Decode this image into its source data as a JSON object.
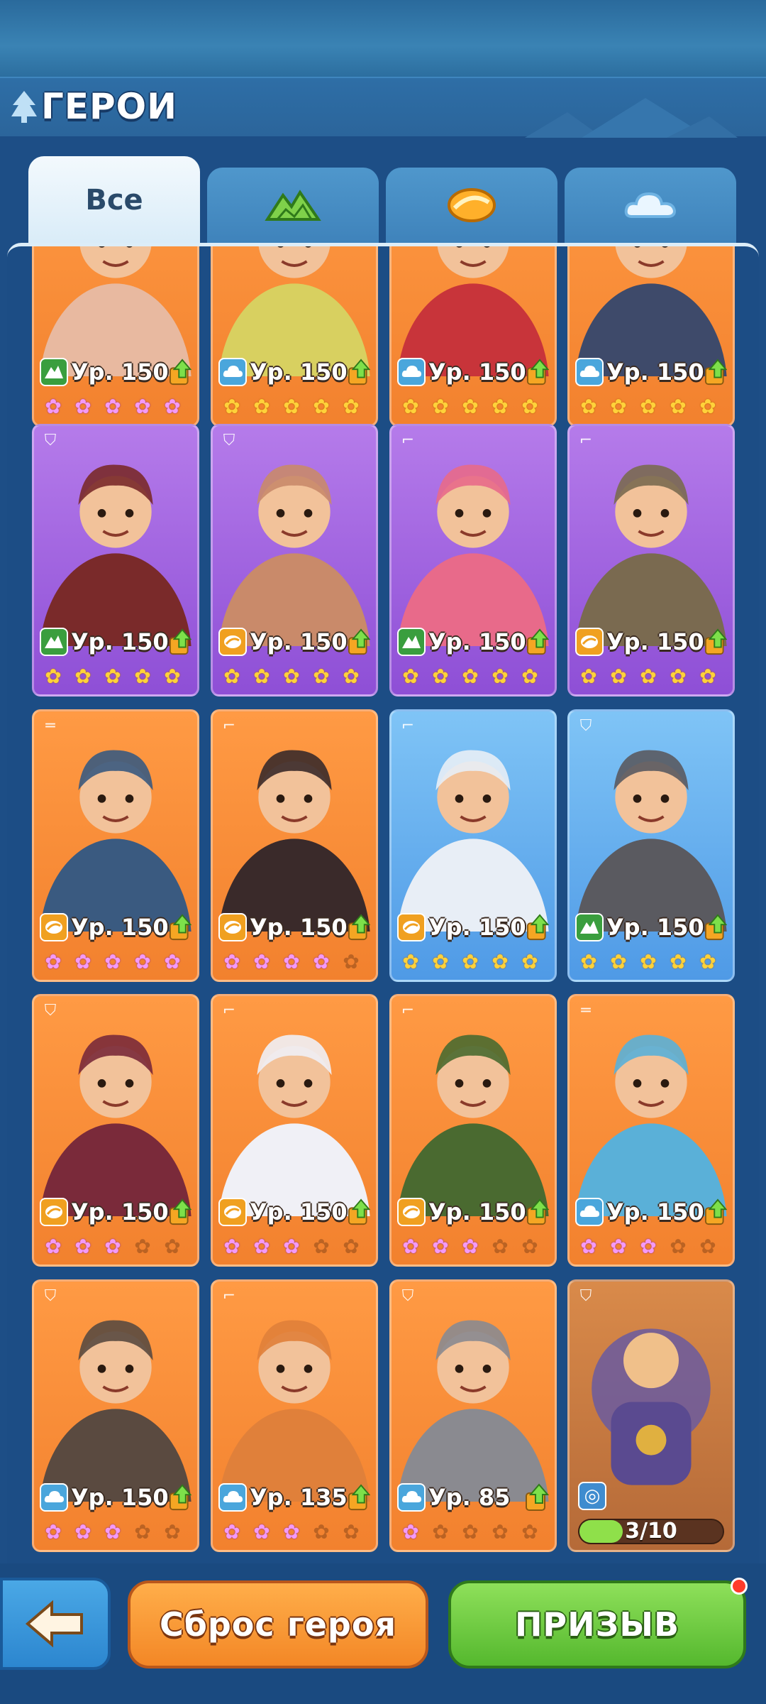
{
  "header": {
    "title": "ГЕРОИ"
  },
  "tabs": [
    {
      "label": "Все",
      "icon": "all"
    },
    {
      "label": "",
      "icon": "mountain-element-icon"
    },
    {
      "label": "",
      "icon": "sun-element-icon"
    },
    {
      "label": "",
      "icon": "cloud-element-icon"
    }
  ],
  "colors": {
    "gold_star": "#ffd23a",
    "pink_star": "#f49af7",
    "orange_card": "#f2812e",
    "purple_card": "#8e4fd6",
    "blue_card": "#4f9ae6",
    "progress_fill": "#8fe04a"
  },
  "heroes": [
    {
      "row": 0,
      "col": 0,
      "element": "mountain",
      "level": "Ур. 150",
      "card": "orange",
      "class": "",
      "stars": [
        "pink",
        "pink",
        "pink",
        "pink",
        "pink"
      ],
      "figure": "#e8b9a0"
    },
    {
      "row": 0,
      "col": 1,
      "element": "cloud",
      "level": "Ур. 150",
      "card": "orange",
      "class": "",
      "stars": [
        "gold",
        "gold",
        "gold",
        "gold",
        "gold"
      ],
      "figure": "#d8d060"
    },
    {
      "row": 0,
      "col": 2,
      "element": "cloud",
      "level": "Ур. 150",
      "card": "orange",
      "class": "",
      "stars": [
        "gold",
        "gold",
        "gold",
        "gold",
        "gold"
      ],
      "figure": "#c8343a"
    },
    {
      "row": 0,
      "col": 3,
      "element": "cloud",
      "level": "Ур. 150",
      "card": "orange",
      "class": "",
      "stars": [
        "gold",
        "gold",
        "gold",
        "gold",
        "gold"
      ],
      "figure": "#3e4a6a"
    },
    {
      "row": 1,
      "col": 0,
      "element": "mountain",
      "level": "Ур. 150",
      "card": "purple",
      "class": "shield",
      "stars": [
        "gold",
        "gold",
        "gold",
        "gold",
        "gold"
      ],
      "figure": "#7a2a2a"
    },
    {
      "row": 1,
      "col": 1,
      "element": "sun",
      "level": "Ур. 150",
      "card": "purple",
      "class": "shield",
      "stars": [
        "gold",
        "gold",
        "gold",
        "gold",
        "gold"
      ],
      "figure": "#c98a6a"
    },
    {
      "row": 1,
      "col": 2,
      "element": "mountain",
      "level": "Ур. 150",
      "card": "purple",
      "class": "gun",
      "stars": [
        "gold",
        "gold",
        "gold",
        "gold",
        "gold"
      ],
      "figure": "#e86a8a"
    },
    {
      "row": 1,
      "col": 3,
      "element": "sun",
      "level": "Ур. 150",
      "card": "purple",
      "class": "gun",
      "stars": [
        "gold",
        "gold",
        "gold",
        "gold",
        "gold"
      ],
      "figure": "#7a6a50"
    },
    {
      "row": 2,
      "col": 0,
      "element": "sun",
      "level": "Ур. 150",
      "card": "orange",
      "class": "rifle",
      "stars": [
        "pink",
        "pink",
        "pink",
        "pink",
        "pink"
      ],
      "figure": "#3a5a80"
    },
    {
      "row": 2,
      "col": 1,
      "element": "sun",
      "level": "Ур. 150",
      "card": "orange",
      "class": "gun",
      "stars": [
        "pink",
        "pink",
        "pink",
        "pink",
        "empty"
      ],
      "figure": "#3a2a2a"
    },
    {
      "row": 2,
      "col": 2,
      "element": "sun",
      "level": "Ур. 150",
      "card": "blue",
      "class": "gun",
      "stars": [
        "gold",
        "gold",
        "gold",
        "gold",
        "gold"
      ],
      "figure": "#e8eef6"
    },
    {
      "row": 2,
      "col": 3,
      "element": "mountain",
      "level": "Ур. 150",
      "card": "blue",
      "class": "shield",
      "stars": [
        "gold",
        "gold",
        "gold",
        "gold",
        "gold"
      ],
      "figure": "#5a5a60"
    },
    {
      "row": 3,
      "col": 0,
      "element": "sun",
      "level": "Ур. 150",
      "card": "orange",
      "class": "shield",
      "stars": [
        "pink",
        "pink",
        "pink",
        "empty",
        "empty"
      ],
      "figure": "#7a2a3a"
    },
    {
      "row": 3,
      "col": 1,
      "element": "sun",
      "level": "Ур. 150",
      "card": "orange",
      "class": "gun",
      "stars": [
        "pink",
        "pink",
        "pink",
        "empty",
        "empty"
      ],
      "figure": "#f0f0f6"
    },
    {
      "row": 3,
      "col": 2,
      "element": "sun",
      "level": "Ур. 150",
      "card": "orange",
      "class": "gun",
      "stars": [
        "pink",
        "pink",
        "pink",
        "empty",
        "empty"
      ],
      "figure": "#4a6a30"
    },
    {
      "row": 3,
      "col": 3,
      "element": "cloud",
      "level": "Ур. 150",
      "card": "orange",
      "class": "rifle",
      "stars": [
        "pink",
        "pink",
        "pink",
        "empty",
        "empty"
      ],
      "figure": "#5ab0d8"
    },
    {
      "row": 4,
      "col": 0,
      "element": "cloud",
      "level": "Ур. 150",
      "card": "orange",
      "class": "shield",
      "stars": [
        "pink",
        "pink",
        "pink",
        "empty",
        "empty"
      ],
      "figure": "#5a4a40"
    },
    {
      "row": 4,
      "col": 1,
      "element": "cloud",
      "level": "Ур. 135",
      "card": "orange",
      "class": "gun",
      "stars": [
        "pink",
        "pink",
        "pink",
        "empty",
        "empty"
      ],
      "figure": "#e0803a"
    },
    {
      "row": 4,
      "col": 2,
      "element": "cloud",
      "level": "Ур. 85",
      "card": "orange",
      "class": "shield",
      "stars": [
        "pink",
        "empty",
        "empty",
        "empty",
        "empty"
      ],
      "figure": "#8a8a90"
    }
  ],
  "locked_hero": {
    "progress_text": "3/10",
    "progress": 0.3,
    "class": "shield",
    "figure": "#6a5aa0"
  },
  "buttons": {
    "back": "back-arrow",
    "reset": "Сброс героя",
    "summon": "ПРИЗЫВ"
  }
}
